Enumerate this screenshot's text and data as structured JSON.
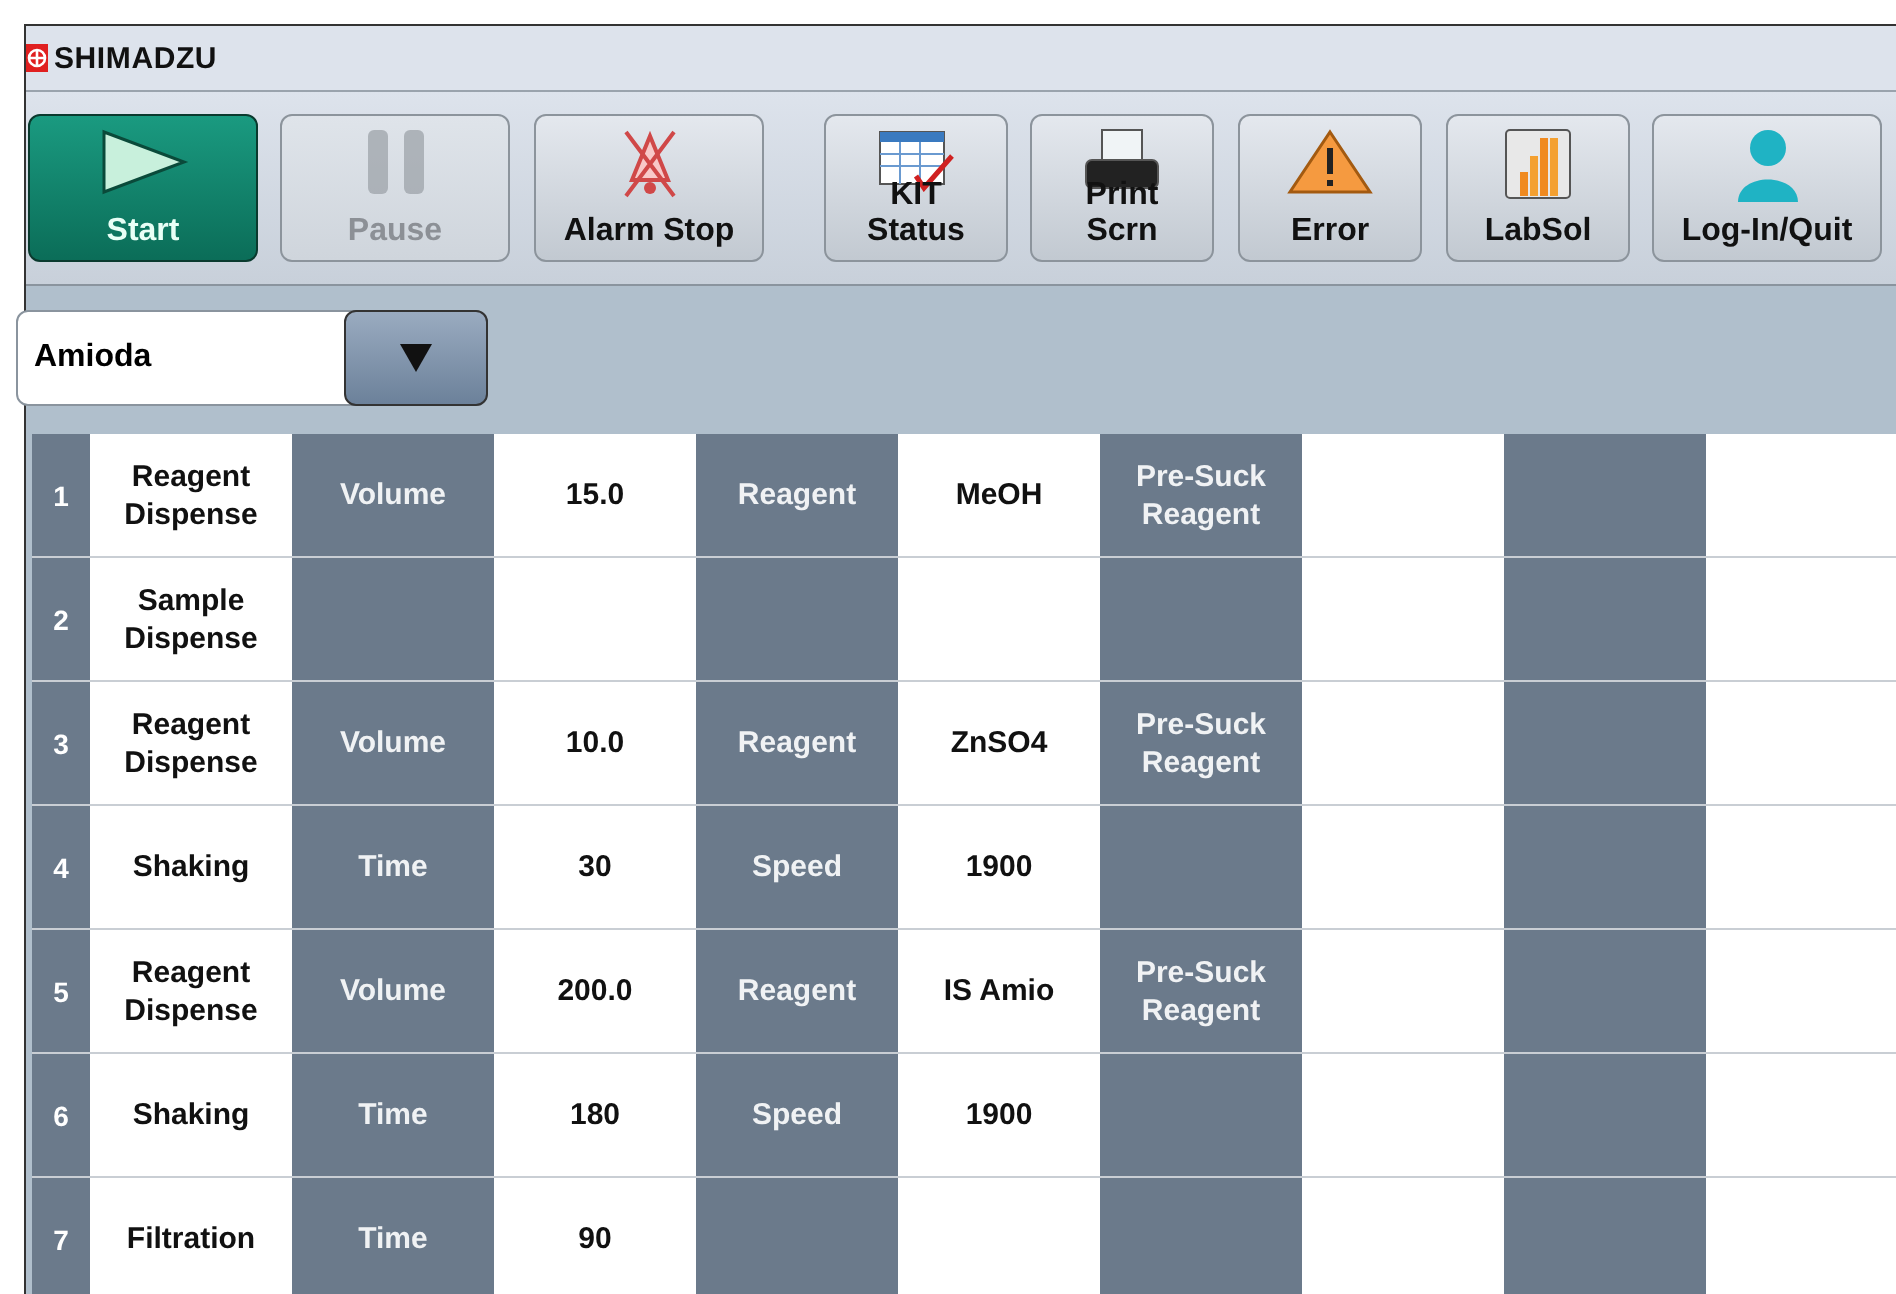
{
  "brand": "SHIMADZU",
  "toolbar": [
    {
      "kind": "start",
      "label": "Start",
      "primary": true,
      "disabled": false
    },
    {
      "kind": "pause",
      "label": "Pause",
      "primary": false,
      "disabled": true
    },
    {
      "kind": "alarm",
      "label": "Alarm Stop",
      "primary": false,
      "disabled": false
    },
    {
      "kind": "kit",
      "overlay": "KIT",
      "label": "Status",
      "primary": false,
      "disabled": false
    },
    {
      "kind": "print",
      "overlay": "Print",
      "label": "Scrn",
      "primary": false,
      "disabled": false
    },
    {
      "kind": "error",
      "label": "Error",
      "primary": false,
      "disabled": false
    },
    {
      "kind": "labsol",
      "label": "LabSol",
      "primary": false,
      "disabled": false
    },
    {
      "kind": "login",
      "label": "Log-In/Quit",
      "primary": false,
      "disabled": false
    }
  ],
  "method_select": {
    "value": "Amioda"
  },
  "steps": [
    {
      "number": "1",
      "name": "Reagent Dispense",
      "params": [
        {
          "label": "Volume",
          "value": "15.0"
        },
        {
          "label": "Reagent",
          "value": "MeOH"
        },
        {
          "label": "Pre-Suck Reagent"
        }
      ]
    },
    {
      "number": "2",
      "name": "Sample Dispense"
    },
    {
      "number": "3",
      "name": "Reagent Dispense",
      "params": [
        {
          "label": "Volume",
          "value": "10.0"
        },
        {
          "label": "Reagent",
          "value": "ZnSO4"
        },
        {
          "label": "Pre-Suck Reagent"
        }
      ]
    },
    {
      "number": "4",
      "name": "Shaking",
      "params": [
        {
          "label": "Time",
          "value": "30"
        },
        {
          "label": "Speed",
          "value": "1900"
        }
      ]
    },
    {
      "number": "5",
      "name": "Reagent Dispense",
      "params": [
        {
          "label": "Volume",
          "value": "200.0"
        },
        {
          "label": "Reagent",
          "value": "IS Amio"
        },
        {
          "label": "Pre-Suck Reagent"
        }
      ]
    },
    {
      "number": "6",
      "name": "Shaking",
      "params": [
        {
          "label": "Time",
          "value": "180"
        },
        {
          "label": "Speed",
          "value": "1900"
        }
      ]
    },
    {
      "number": "7",
      "name": "Filtration",
      "params": [
        {
          "label": "Time",
          "value": "90"
        }
      ]
    }
  ]
}
